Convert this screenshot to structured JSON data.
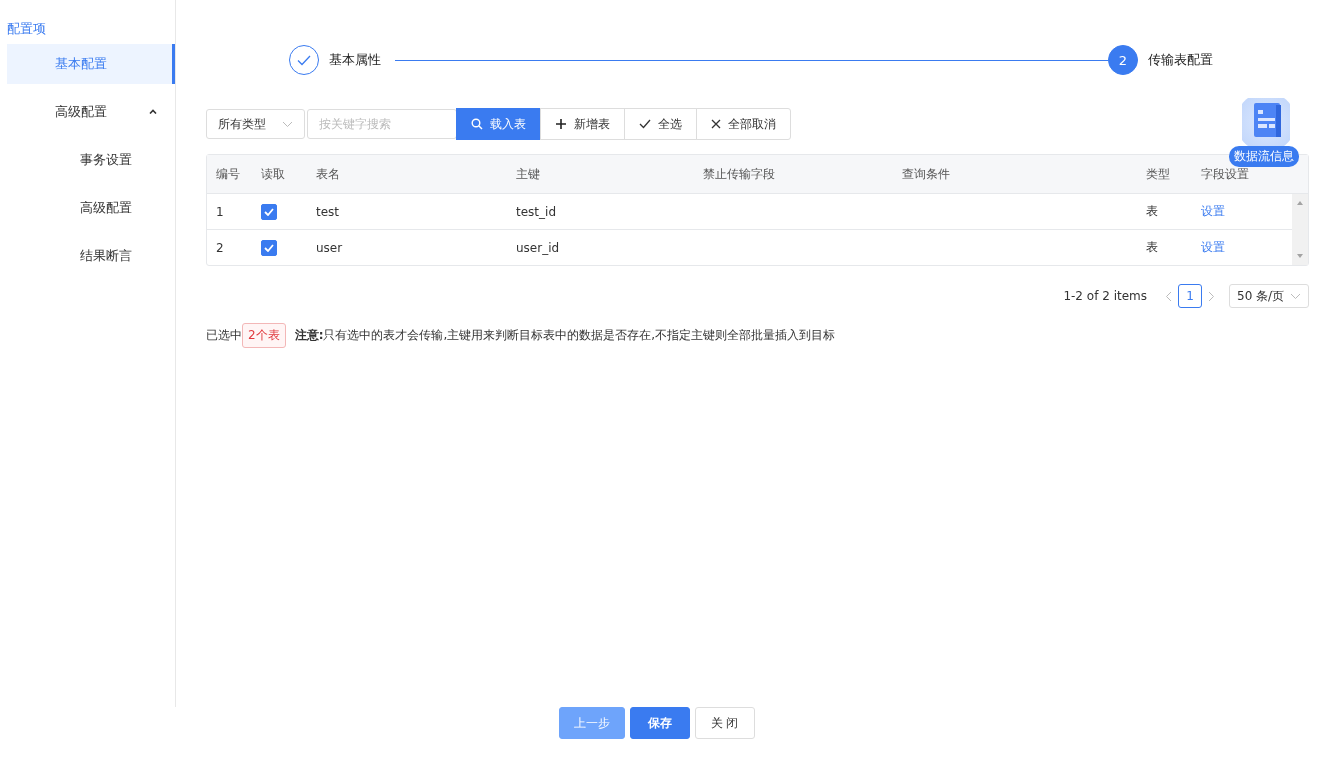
{
  "sidebar": {
    "title": "配置项",
    "items": [
      {
        "label": "基本配置",
        "selected": true
      },
      {
        "label": "高级配置",
        "selected": false,
        "expanded": true,
        "children": [
          {
            "label": "事务设置",
            "selected": false
          },
          {
            "label": "高级配置",
            "selected": false
          },
          {
            "label": "结果断言",
            "selected": false
          }
        ]
      }
    ]
  },
  "steps": [
    {
      "kind": "done",
      "label": "基本属性"
    },
    {
      "kind": "active",
      "number": "2",
      "label": "传输表配置"
    }
  ],
  "toolbar": {
    "type_select": "所有类型",
    "search": {
      "placeholder": "按关键字搜索"
    },
    "buttons": [
      {
        "kind": "search",
        "label": "载入表",
        "primary": true
      },
      {
        "kind": "plus",
        "label": "新增表",
        "primary": false
      },
      {
        "kind": "check",
        "label": "全选",
        "primary": false
      },
      {
        "kind": "close",
        "label": "全部取消",
        "primary": false
      }
    ]
  },
  "float_badge": {
    "label": "数据流信息"
  },
  "table": {
    "columns": [
      "编号",
      "读取",
      "表名",
      "主键",
      "禁止传输字段",
      "查询条件",
      "类型",
      "字段设置"
    ],
    "rows": [
      {
        "index": "1",
        "checked": true,
        "name": "test",
        "key": "test_id",
        "type": "表",
        "action": "设置"
      },
      {
        "index": "2",
        "checked": true,
        "name": "user",
        "key": "user_id",
        "type": "表",
        "action": "设置"
      }
    ]
  },
  "pagination": {
    "summary": "1-2 of 2 items",
    "pages": [
      {
        "label": "1",
        "selected": true
      }
    ],
    "page_size": "50 条/页"
  },
  "selection": {
    "prefix": "已选中",
    "tag": "2个表",
    "note": "**注意:**只有选中的表才会传输,主键用来判断目标表中的数据是否存在,不指定主键则全部批量插入到目标"
  },
  "footer_buttons": [
    {
      "label": "上一步",
      "kind": "prev"
    },
    {
      "label": "保存",
      "kind": "primary"
    },
    {
      "label": "关 闭",
      "kind": "default"
    }
  ]
}
